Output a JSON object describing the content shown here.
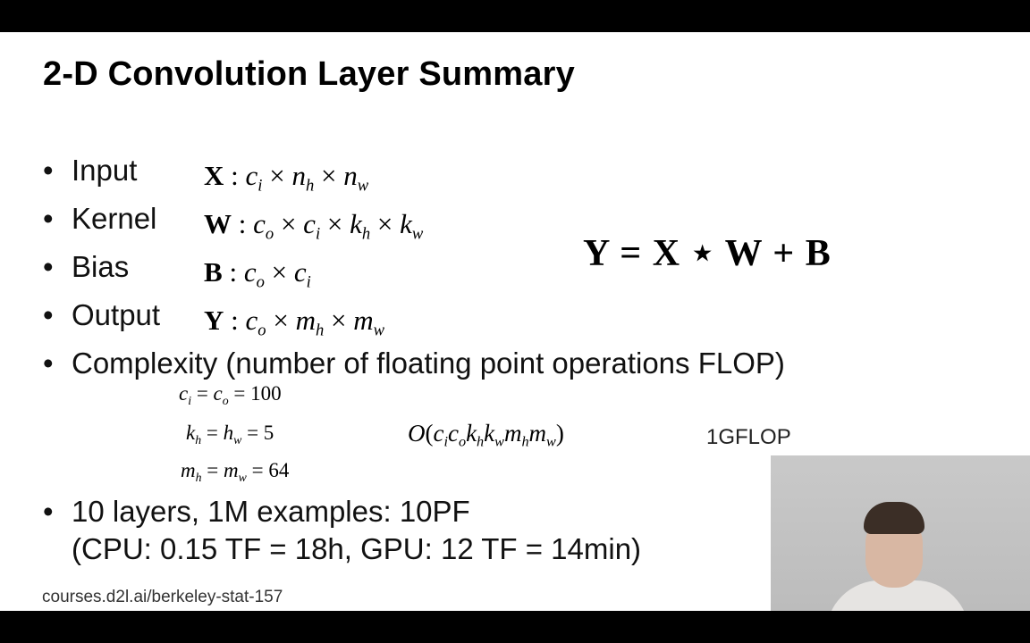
{
  "slide": {
    "title": "2-D Convolution Layer Summary",
    "bullets": {
      "input": "Input",
      "kernel": "Kernel",
      "bias": "Bias",
      "output": "Output",
      "complexity": "Complexity (number of floating point operations FLOP)",
      "layers": "10 layers, 1M examples: 10PF",
      "cpu_gpu": "(CPU: 0.15 TF = 18h, GPU: 12 TF = 14min)"
    },
    "gflop": "1GFLOP",
    "footer": "courses.d2l.ai/berkeley-stat-157",
    "bullet_symbol": "•"
  },
  "webcam": {
    "label": "presenter-webcam"
  }
}
